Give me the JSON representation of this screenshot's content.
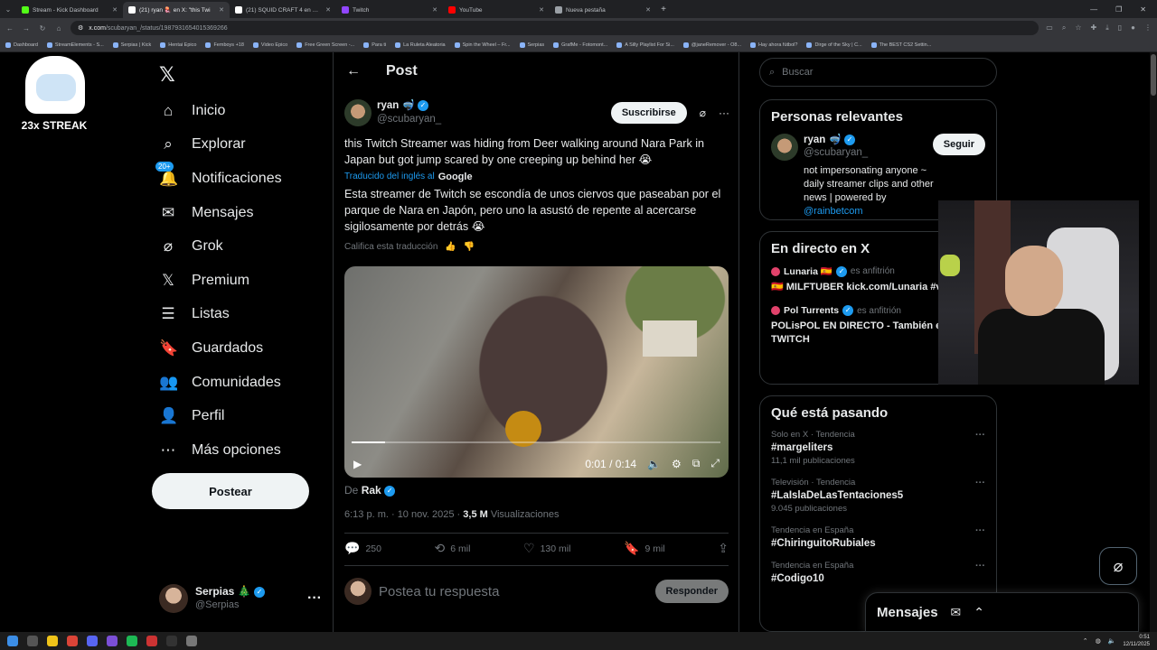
{
  "browser": {
    "tabs": [
      {
        "title": "Stream - Kick Dashboard",
        "color": "#53fc18",
        "active": false
      },
      {
        "title": "(21) ryan 🪼 en X: \"this Twi",
        "color": "#ffffff",
        "active": true
      },
      {
        "title": "(21) SQUID CRAFT 4 en X: \"El c",
        "color": "#ffffff",
        "active": false
      },
      {
        "title": "Twitch",
        "color": "#9146ff",
        "active": false
      },
      {
        "title": "YouTube",
        "color": "#ff0000",
        "active": false
      },
      {
        "title": "Nueva pestaña",
        "color": "#9aa0a6",
        "active": false
      }
    ],
    "url_domain": "x.com",
    "url_path": "/scubaryan_/status/1987931654015369266",
    "bookmarks": [
      "Dashboard",
      "StreamElements - S...",
      "Serpias | Kick",
      "Hentai Epico",
      "Femboys +18",
      "Video Epico",
      "Free Green Screen -...",
      "Para ti",
      "La Ruleta Aleatoria",
      "Spin the Wheel – Fr...",
      "Serpias",
      "GrafMe - Fotomont...",
      "A Silly Playlist For Si...",
      "@janeRemover - O8...",
      "Hay ahora fútbol?",
      "Dirge of the Sky | C...",
      "The BEST CS2 Settin..."
    ]
  },
  "overlay": {
    "streak_text": "23x STREAK"
  },
  "sidebar": {
    "logo": "𝕏",
    "notif_badge": "20+",
    "items": [
      {
        "icon": "⌂",
        "label": "Inicio"
      },
      {
        "icon": "⌕",
        "label": "Explorar"
      },
      {
        "icon": "🔔",
        "label": "Notificaciones"
      },
      {
        "icon": "✉",
        "label": "Mensajes"
      },
      {
        "icon": "⌀",
        "label": "Grok"
      },
      {
        "icon": "𝕏",
        "label": "Premium"
      },
      {
        "icon": "☰",
        "label": "Listas"
      },
      {
        "icon": "🔖",
        "label": "Guardados"
      },
      {
        "icon": "👥",
        "label": "Comunidades"
      },
      {
        "icon": "👤",
        "label": "Perfil"
      },
      {
        "icon": "⋯",
        "label": "Más opciones"
      }
    ],
    "post_button": "Postear",
    "account": {
      "name": "Serpias 🎄",
      "handle": "@Serpias"
    }
  },
  "post": {
    "header_title": "Post",
    "author_name": "ryan 🤿",
    "author_handle": "@scubaryan_",
    "subscribe_label": "Suscribirse",
    "text_en": "this Twitch Streamer was hiding from Deer walking around Nara Park in Japan but got jump scared by one creeping up behind her 😭",
    "translated_label": "Traducido del inglés al",
    "translated_provider": "Google",
    "text_es": "Esta streamer de Twitch se escondía de unos ciervos que paseaban por el parque de Nara en Japón, pero uno la asustó de repente al acercarse sigilosamente por detrás 😭",
    "rate_label": "Califica esta traducción",
    "video_time": "0:01 / 0:14",
    "video_progress": 0.09,
    "from_label": "De",
    "from_name": "Rak",
    "timestamp": "6:13 p. m. · 10 nov. 2025 ·",
    "views_value": "3,5 M",
    "views_label": "Visualizaciones",
    "replies": "250",
    "reposts": "6 mil",
    "likes": "130 mil",
    "bookmarks": "9 mil",
    "reply_placeholder": "Postea tu respuesta",
    "reply_button": "Responder"
  },
  "right": {
    "search_placeholder": "Buscar",
    "relevant_title": "Personas relevantes",
    "rel_name": "ryan 🤿",
    "rel_handle": "@scubaryan_",
    "follow_label": "Seguir",
    "rel_bio": "not impersonating anyone ~ daily streamer clips and other news | powered by",
    "rel_bio_link": "@rainbetcom",
    "live_title": "En directo en X",
    "live": [
      {
        "host": "Lunaria 🇪🇸",
        "role": "es anfitrión",
        "title": "🇪🇸 MILFTUBER kick.com/Lunaria #vtuber"
      },
      {
        "host": "Pol Turrents",
        "role": "es anfitrión",
        "title": "POLisPOL EN DIRECTO - También en TWITCH"
      }
    ],
    "trending_title": "Qué está pasando",
    "trends": [
      {
        "context": "Solo en X · Tendencia",
        "tag": "#margeliters",
        "count": "11,1 mil publicaciones"
      },
      {
        "context": "Televisión · Tendencia",
        "tag": "#LaIslaDeLasTentaciones5",
        "count": "9.045 publicaciones"
      },
      {
        "context": "Tendencia en España",
        "tag": "#ChiringuitoRubiales",
        "count": ""
      },
      {
        "context": "Tendencia en España",
        "tag": "#Codigo10",
        "count": ""
      }
    ],
    "messages_label": "Mensajes"
  },
  "taskbar": {
    "time": "0:51",
    "date": "12/11/2025"
  }
}
